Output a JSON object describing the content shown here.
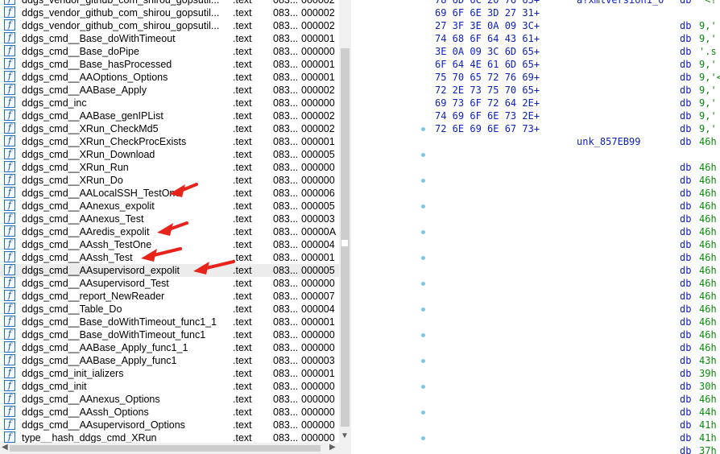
{
  "functions": [
    {
      "name": "ddgs_vendor_github_com_shirou_gopsutil...",
      "seg": ".text",
      "start": "083...",
      "len": "000002"
    },
    {
      "name": "ddgs_vendor_github_com_shirou_gopsutil...",
      "seg": ".text",
      "start": "083...",
      "len": "000002"
    },
    {
      "name": "ddgs_vendor_github_com_shirou_gopsutil...",
      "seg": ".text",
      "start": "083...",
      "len": "000002"
    },
    {
      "name": "ddgs_cmd__Base_doWithTimeout",
      "seg": ".text",
      "start": "083...",
      "len": "000001"
    },
    {
      "name": "ddgs_cmd__Base_doPipe",
      "seg": ".text",
      "start": "083...",
      "len": "000000"
    },
    {
      "name": "ddgs_cmd__Base_hasProcessed",
      "seg": ".text",
      "start": "083...",
      "len": "000001"
    },
    {
      "name": "ddgs_cmd__AAOptions_Options",
      "seg": ".text",
      "start": "083...",
      "len": "000001"
    },
    {
      "name": "ddgs_cmd__AABase_Apply",
      "seg": ".text",
      "start": "083...",
      "len": "000002"
    },
    {
      "name": "ddgs_cmd_inc",
      "seg": ".text",
      "start": "083...",
      "len": "000000"
    },
    {
      "name": "ddgs_cmd__AABase_genIPList",
      "seg": ".text",
      "start": "083...",
      "len": "000002"
    },
    {
      "name": "ddgs_cmd__XRun_CheckMd5",
      "seg": ".text",
      "start": "083...",
      "len": "000002"
    },
    {
      "name": "ddgs_cmd__XRun_CheckProcExists",
      "seg": ".text",
      "start": "083...",
      "len": "000001"
    },
    {
      "name": "ddgs_cmd__XRun_Download",
      "seg": ".text",
      "start": "083...",
      "len": "000005"
    },
    {
      "name": "ddgs_cmd__XRun_Run",
      "seg": ".text",
      "start": "083...",
      "len": "000000"
    },
    {
      "name": "ddgs_cmd__XRun_Do",
      "seg": ".text",
      "start": "083...",
      "len": "000000"
    },
    {
      "name": "ddgs_cmd__AALocalSSH_TestOne",
      "seg": ".text",
      "start": "083...",
      "len": "000006"
    },
    {
      "name": "ddgs_cmd__AAnexus_expolit",
      "seg": ".text",
      "start": "083...",
      "len": "000005"
    },
    {
      "name": "ddgs_cmd__AAnexus_Test",
      "seg": ".text",
      "start": "083...",
      "len": "000003"
    },
    {
      "name": "ddgs_cmd__AAredis_expolit",
      "seg": ".text",
      "start": "083...",
      "len": "00000A"
    },
    {
      "name": "ddgs_cmd__AAssh_TestOne",
      "seg": ".text",
      "start": "083...",
      "len": "000004"
    },
    {
      "name": "ddgs_cmd__AAssh_Test",
      "seg": ".text",
      "start": "083...",
      "len": "000001"
    },
    {
      "name": "ddgs_cmd__AAsupervisord_expolit",
      "seg": ".text",
      "start": "083...",
      "len": "000005"
    },
    {
      "name": "ddgs_cmd__AAsupervisord_Test",
      "seg": ".text",
      "start": "083...",
      "len": "000000"
    },
    {
      "name": "ddgs_cmd__report_NewReader",
      "seg": ".text",
      "start": "083...",
      "len": "000007"
    },
    {
      "name": "ddgs_cmd__Table_Do",
      "seg": ".text",
      "start": "083...",
      "len": "000004"
    },
    {
      "name": "ddgs_cmd__Base_doWithTimeout_func1_1",
      "seg": ".text",
      "start": "083...",
      "len": "000001"
    },
    {
      "name": "ddgs_cmd__Base_doWithTimeout_func1",
      "seg": ".text",
      "start": "083...",
      "len": "000000"
    },
    {
      "name": "ddgs_cmd__AABase_Apply_func1_1",
      "seg": ".text",
      "start": "083...",
      "len": "000000"
    },
    {
      "name": "ddgs_cmd__AABase_Apply_func1",
      "seg": ".text",
      "start": "083...",
      "len": "000003"
    },
    {
      "name": "ddgs_cmd_init_ializers",
      "seg": ".text",
      "start": "083...",
      "len": "000001"
    },
    {
      "name": "ddgs_cmd_init",
      "seg": ".text",
      "start": "083...",
      "len": "000000"
    },
    {
      "name": "ddgs_cmd__AAnexus_Options",
      "seg": ".text",
      "start": "083...",
      "len": "000000"
    },
    {
      "name": "ddgs_cmd__AAssh_Options",
      "seg": ".text",
      "start": "083...",
      "len": "000000"
    },
    {
      "name": "ddgs_cmd__AAsupervisord_Options",
      "seg": ".text",
      "start": "083...",
      "len": "000000"
    },
    {
      "name": "type__hash_ddgs_cmd_XRun",
      "seg": ".text",
      "start": "083...",
      "len": "000000"
    }
  ],
  "selected_index": 21,
  "arrow_targets": [
    15,
    18,
    20,
    21
  ],
  "disasm": [
    {
      "hex": "78 6D 6C 20 76 65+",
      "label": "a?xmlversion1_0",
      "mn": "db",
      "op": "'<?"
    },
    {
      "hex": "69 6F 6E 3D 27 31+",
      "label": "",
      "mn": "",
      "op": ""
    },
    {
      "hex": "27 3F 3E 0A 09 3C+",
      "label": "",
      "mn": "db",
      "op": "9,'"
    },
    {
      "hex": "74 68 6F 64 43 61+",
      "label": "",
      "mn": "db",
      "op": "9,'"
    },
    {
      "hex": "3E 0A 09 3C 6D 65+",
      "label": "",
      "mn": "db",
      "op": "'.s"
    },
    {
      "hex": "6F 64 4E 61 6D 65+",
      "label": "",
      "mn": "db",
      "op": "9,'"
    },
    {
      "hex": "75 70 65 72 76 69+",
      "label": "",
      "mn": "db",
      "op": "9,'<"
    },
    {
      "hex": "72 2E 73 75 70 65+",
      "label": "",
      "mn": "db",
      "op": "9,'"
    },
    {
      "hex": "69 73 6F 72 64 2E+",
      "label": "",
      "mn": "db",
      "op": "9,'"
    },
    {
      "hex": "74 69 6F 6E 73 2E+",
      "label": "",
      "mn": "db",
      "op": "9,'"
    },
    {
      "hex": "72 6E 69 6E 67 73+",
      "label": "",
      "mn": "db",
      "op": "9,'"
    },
    {
      "hex": "",
      "label": "unk_857EB99",
      "mn": "db",
      "op": "46h"
    },
    {
      "hex": "",
      "label": "",
      "mn": "",
      "op": ""
    },
    {
      "hex": "",
      "label": "",
      "mn": "db",
      "op": "46h"
    },
    {
      "hex": "",
      "label": "",
      "mn": "db",
      "op": "46h"
    },
    {
      "hex": "",
      "label": "",
      "mn": "db",
      "op": "46h"
    },
    {
      "hex": "",
      "label": "",
      "mn": "db",
      "op": "46h"
    },
    {
      "hex": "",
      "label": "",
      "mn": "db",
      "op": "46h"
    },
    {
      "hex": "",
      "label": "",
      "mn": "db",
      "op": "46h"
    },
    {
      "hex": "",
      "label": "",
      "mn": "db",
      "op": "46h"
    },
    {
      "hex": "",
      "label": "",
      "mn": "db",
      "op": "46h"
    },
    {
      "hex": "",
      "label": "",
      "mn": "db",
      "op": "46h"
    },
    {
      "hex": "",
      "label": "",
      "mn": "db",
      "op": "46h"
    },
    {
      "hex": "",
      "label": "",
      "mn": "db",
      "op": "46h"
    },
    {
      "hex": "",
      "label": "",
      "mn": "db",
      "op": "46h"
    },
    {
      "hex": "",
      "label": "",
      "mn": "db",
      "op": "46h"
    },
    {
      "hex": "",
      "label": "",
      "mn": "db",
      "op": "46h"
    },
    {
      "hex": "",
      "label": "",
      "mn": "db",
      "op": "46h"
    },
    {
      "hex": "",
      "label": "",
      "mn": "db",
      "op": "43h"
    },
    {
      "hex": "",
      "label": "",
      "mn": "db",
      "op": "39h"
    },
    {
      "hex": "",
      "label": "",
      "mn": "db",
      "op": "30h"
    },
    {
      "hex": "",
      "label": "",
      "mn": "db",
      "op": "46h"
    },
    {
      "hex": "",
      "label": "",
      "mn": "db",
      "op": "44h"
    },
    {
      "hex": "",
      "label": "",
      "mn": "db",
      "op": "41h"
    },
    {
      "hex": "",
      "label": "",
      "mn": "db",
      "op": "41h"
    },
    {
      "hex": "",
      "label": "",
      "mn": "db",
      "op": "37h"
    }
  ],
  "dot_rows": [
    10,
    12,
    14,
    16,
    18,
    20,
    22,
    24,
    26,
    28,
    30,
    32,
    34
  ],
  "colors": {
    "arrow": "#e8231b",
    "hex": "#0a1fbf",
    "operand": "#0a8a0a",
    "selection": "#ececec"
  },
  "icons": {
    "function": "function-f-icon",
    "scroll_up": "triangle-up-icon",
    "scroll_down": "triangle-down-icon"
  }
}
